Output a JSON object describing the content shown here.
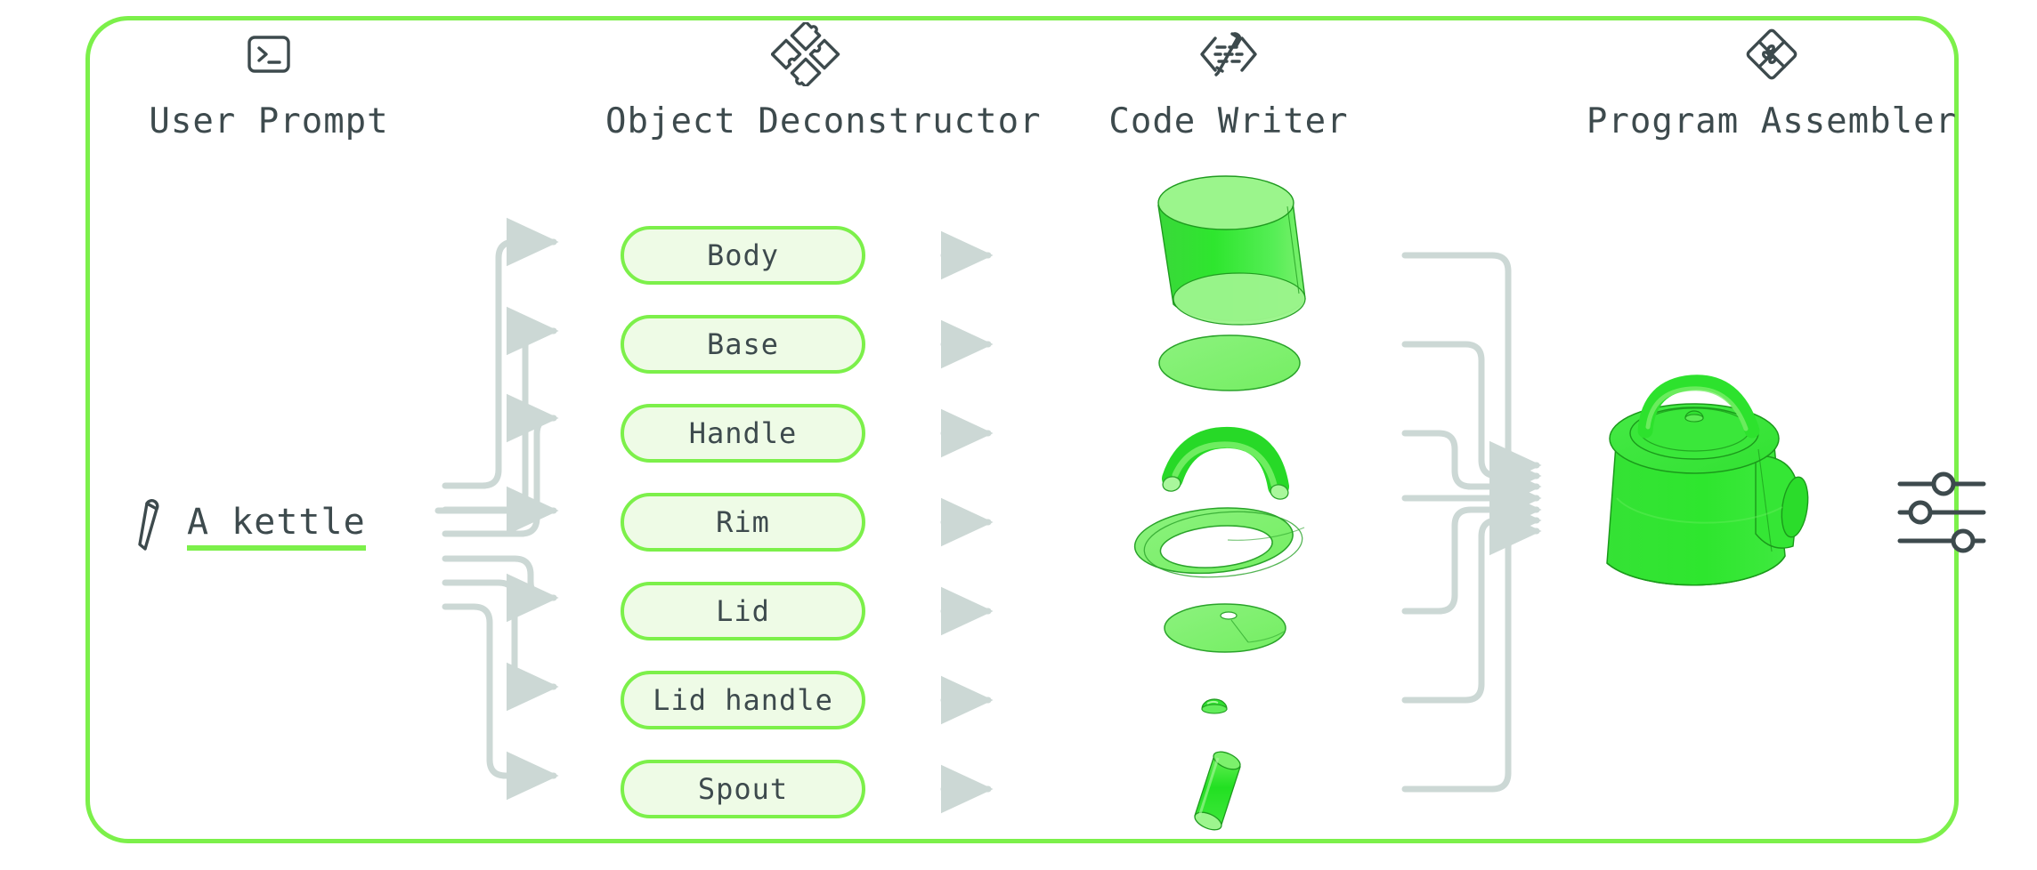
{
  "frame": {
    "accent_color": "#7cf04a"
  },
  "columns": [
    {
      "title": "User Prompt",
      "icon": "terminal-icon"
    },
    {
      "title": "Object Deconstructor",
      "icon": "puzzle-exploded-icon"
    },
    {
      "title": "Code Writer",
      "icon": "code-pencil-icon"
    },
    {
      "title": "Program Assembler",
      "icon": "puzzle-assembled-icon"
    }
  ],
  "prompt": {
    "icon": "pen-icon",
    "text": "A kettle"
  },
  "parts": [
    {
      "label": "Body",
      "shape": "frustum-cylinder"
    },
    {
      "label": "Base",
      "shape": "flat-ellipse-disc"
    },
    {
      "label": "Handle",
      "shape": "curved-tube-arc"
    },
    {
      "label": "Rim",
      "shape": "annulus-ring"
    },
    {
      "label": "Lid",
      "shape": "flat-ellipse-disc-with-hole"
    },
    {
      "label": "Lid handle",
      "shape": "small-dome-knob"
    },
    {
      "label": "Spout",
      "shape": "tilted-cylinder"
    }
  ],
  "result": {
    "name": "assembled-kettle",
    "model_color": "#33e033"
  },
  "controls": {
    "icon": "sliders-icon",
    "sliders": [
      {
        "position": 52
      },
      {
        "position": 24
      },
      {
        "position": 76
      }
    ]
  },
  "colors": {
    "accent_green": "#7cf04a",
    "pill_fill": "#eefbe6",
    "text_slate": "#3d4a4d",
    "wire_grey": "#ccd8d5",
    "model_green": "#33e033"
  }
}
